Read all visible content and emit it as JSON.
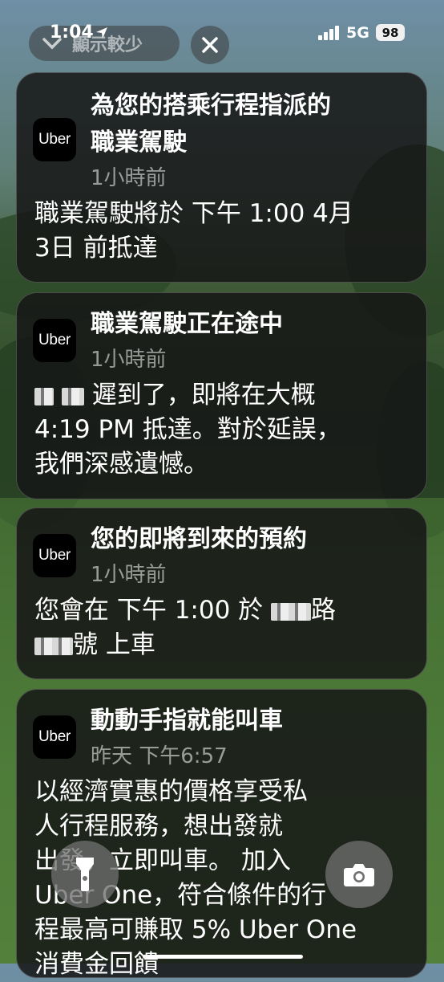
{
  "status_bar": {
    "time": "1:04",
    "network": "5G",
    "battery": "98"
  },
  "controls": {
    "show_less_label": "顯示較少"
  },
  "notifications": [
    {
      "app": "Uber",
      "title_line1": "為您的搭乘行程指派的",
      "title_line2": "職業駕駛",
      "time": "1小時前",
      "body_line1": "職業駕駛將於 下午 1:00 4月",
      "body_line2": "3日 前抵達"
    },
    {
      "app": "Uber",
      "title": "職業駕駛正在途中",
      "time": "1小時前",
      "body_line1": "遲到了，即將在大概",
      "body_line2": "4:19 PM 抵達。對於延誤，",
      "body_line3": "我們深感遺憾。"
    },
    {
      "app": "Uber",
      "title": "您的即將到來的預約",
      "time": "1小時前",
      "body_line1_pre": "您會在 下午 1:00 於",
      "body_line1_post": "路",
      "body_line2_post": "號 上車"
    },
    {
      "app": "Uber",
      "title": "動動手指就能叫車",
      "time": "昨天 下午6:57",
      "body_line1": "以經濟實惠的價格享受私",
      "body_line2": "人行程服務，想出發就",
      "body_line3": "出發，立即叫車。 加入",
      "body_line4": "Uber One，符合條件的行",
      "body_line5": "程最高可賺取 5% Uber One",
      "body_line6": "消費金回饋"
    }
  ],
  "icons": {
    "location": "location-arrow-icon",
    "signal": "cellular-signal-icon",
    "chevron": "chevron-down-icon",
    "close": "close-icon",
    "flashlight": "flashlight-icon",
    "camera": "camera-icon"
  }
}
